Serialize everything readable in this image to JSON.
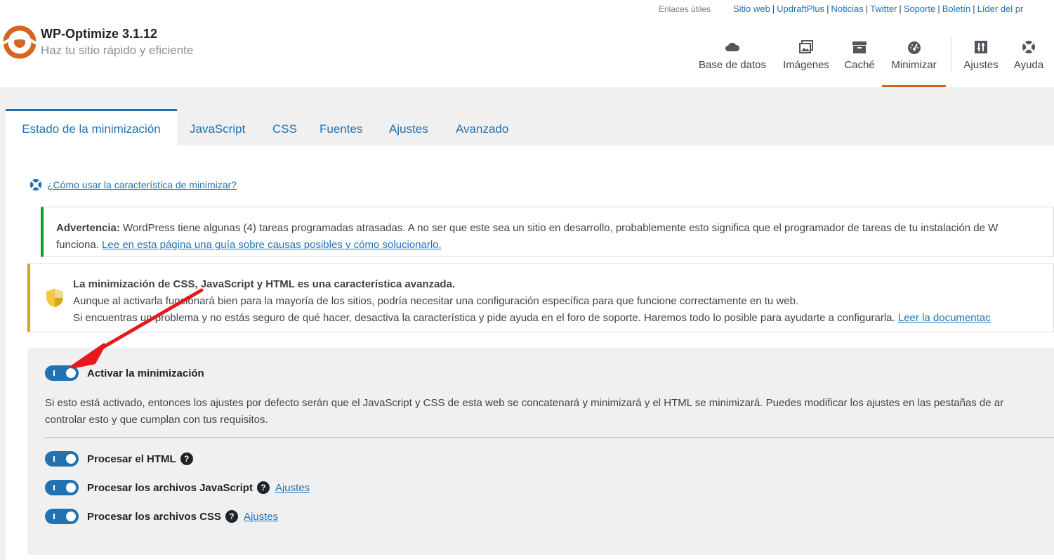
{
  "header": {
    "useful_links_label": "Enlaces útiles",
    "links": [
      "Sitio web",
      "UpdraftPlus",
      "Noticias",
      "Twitter",
      "Soporte",
      "Boletín",
      "Líder del pr"
    ],
    "app_title": "WP-Optimize 3.1.12",
    "app_subtitle": "Haz tu sitio rápido y eficiente",
    "nav": {
      "database": "Base de datos",
      "images": "Imágenes",
      "cache": "Caché",
      "minify": "Minimizar",
      "settings": "Ajustes",
      "help": "Ayuda"
    },
    "active_nav": "Minimizar",
    "brand_color": "#d4661f"
  },
  "tabs": {
    "status": "Estado de la minimización",
    "javascript": "JavaScript",
    "css": "CSS",
    "fonts": "Fuentes",
    "settings": "Ajustes",
    "advanced": "Avanzado",
    "active": "Estado de la minimización"
  },
  "howto_link": "¿Cómo usar la característica de minimizar?",
  "notice_warning": {
    "label": "Advertencia:",
    "text": " WordPress tiene algunas (4) tareas programadas atrasadas. A no ser que este sea un sitio en desarrollo, probablemente esto significa que el programador de tareas de tu instalación de W",
    "text2": "funciona. ",
    "link": "Lee en esta página una guía sobre causas posibles y cómo solucionarlo."
  },
  "notice_advanced": {
    "title": "La minimización de CSS, JavaScript y HTML es una característica avanzada.",
    "line1": "Aunque al activarla funcionará bien para la mayoría de los sitios, podría necesitar una configuración específica para que funcione correctamente en tu web.",
    "line2": "Si encuentras un problema y no estás seguro de qué hacer, desactiva la característica y pide ayuda en el foro de soporte. Haremos todo lo posible para ayudarte a configurarla. ",
    "link": "Leer la documentac"
  },
  "settings": {
    "enable_label": "Activar la minimización",
    "enable_on": true,
    "description_line1": "Si esto está activado, entonces los ajustes por defecto serán que el JavaScript y CSS de esta web se concatenará y minimizará y el HTML se minimizará. Puedes modificar los ajustes en las pestañas de ar",
    "description_line2": "controlar esto y que cumplan con tus requisitos.",
    "html_label": "Procesar el HTML",
    "html_on": true,
    "js_label": "Procesar los archivos JavaScript",
    "js_on": true,
    "js_link": "Ajustes",
    "css_label": "Procesar los archivos CSS",
    "css_on": true,
    "css_link": "Ajustes",
    "help_glyph": "?"
  },
  "colors": {
    "accent": "#2271b1",
    "success_border": "#00a32a",
    "warning_border": "#dba617",
    "annotation_arrow": "#e8191b"
  }
}
